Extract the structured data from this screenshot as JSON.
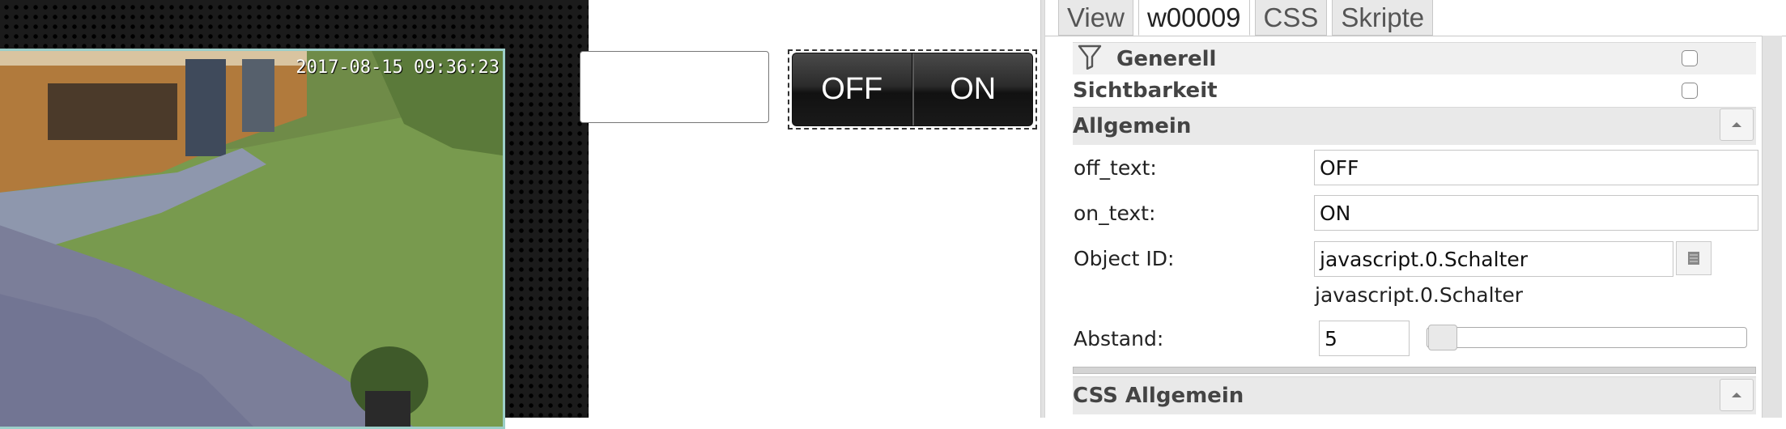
{
  "camera": {
    "timestamp": "2017-08-15 09:36:23"
  },
  "switch_widget": {
    "off_label": "OFF",
    "on_label": "ON"
  },
  "tabs": [
    {
      "label": "View",
      "active": false
    },
    {
      "label": "w00009",
      "active": true
    },
    {
      "label": "CSS",
      "active": false
    },
    {
      "label": "Skripte",
      "active": false
    }
  ],
  "groups": {
    "generell": "Generell",
    "sichtbarkeit": "Sichtbarkeit",
    "allgemein": "Allgemein",
    "css_allgemein": "CSS Allgemein"
  },
  "fields": {
    "off_text": {
      "label": "off_text:",
      "value": "OFF"
    },
    "on_text": {
      "label": "on_text:",
      "value": "ON"
    },
    "object_id": {
      "label": "Object ID:",
      "value": "javascript.0.Schalter",
      "hint": "javascript.0.Schalter"
    },
    "abstand": {
      "label": "Abstand:",
      "value": "5",
      "slider_fraction": 0.0
    }
  },
  "icons": {
    "filter": "filter-icon",
    "collapse": "triangle-up-icon",
    "select": "list-icon"
  }
}
